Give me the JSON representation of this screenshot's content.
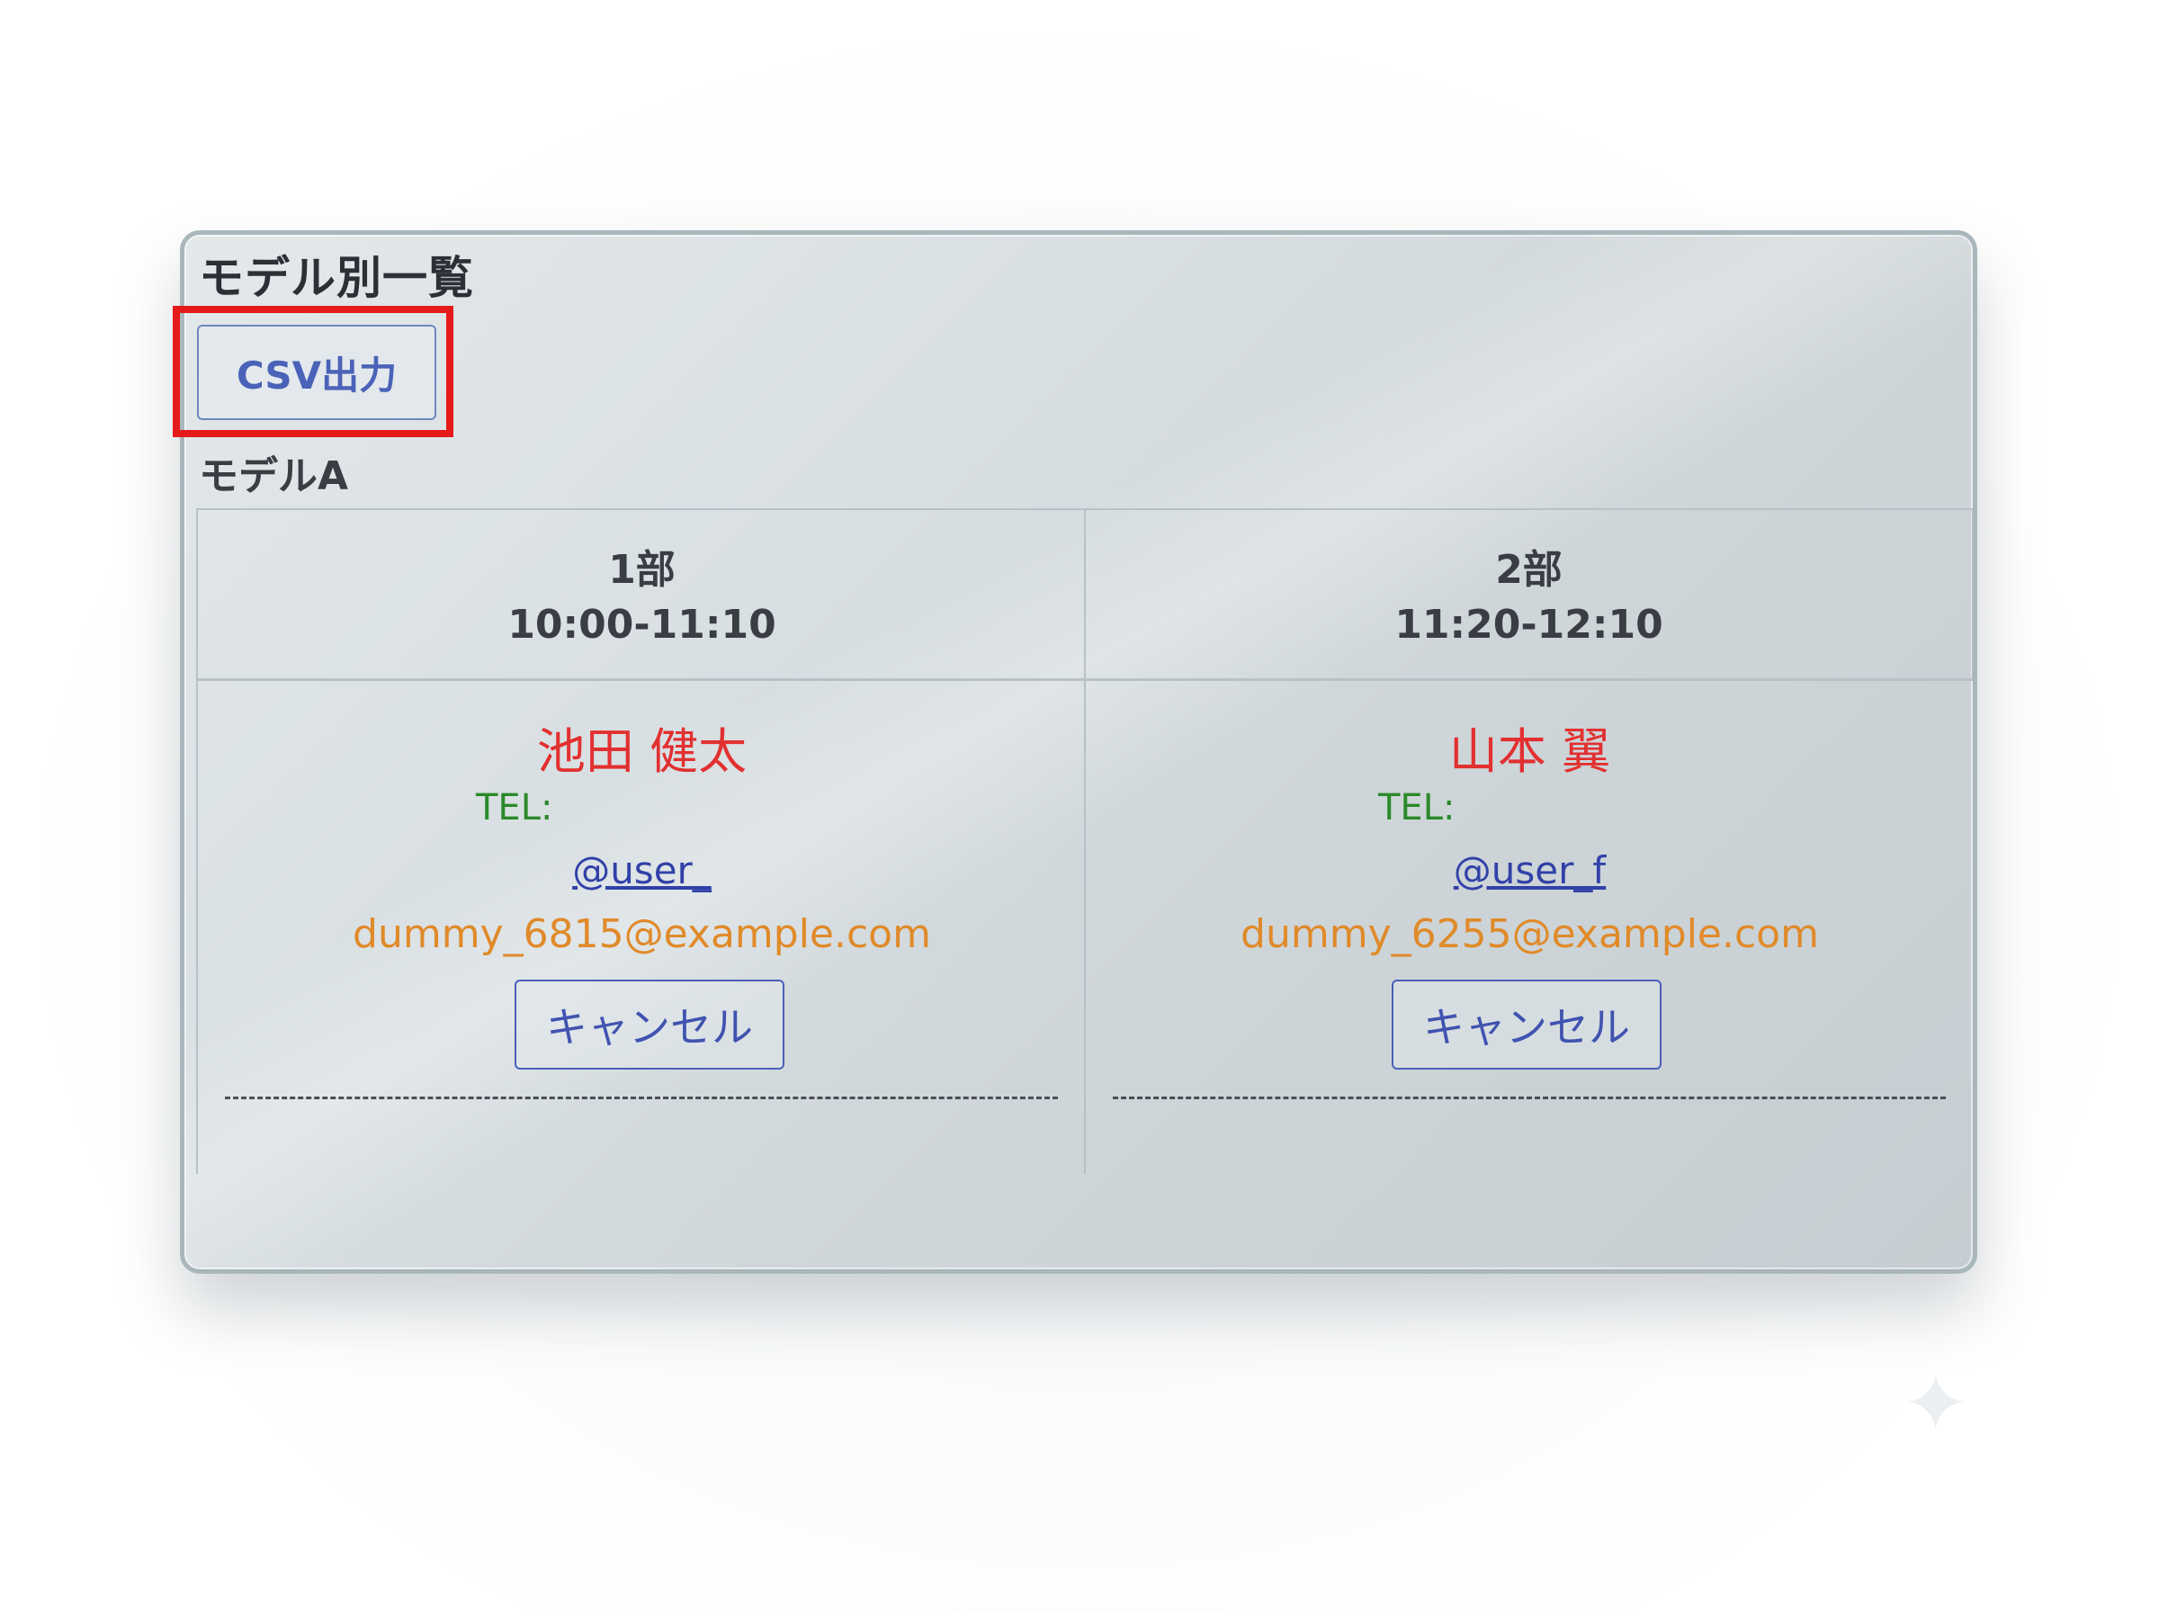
{
  "page_title": "モデル別一覧",
  "toolbar": {
    "csv_label": "CSV出力"
  },
  "model": {
    "name": "モデルA",
    "slots": [
      {
        "label": "1部",
        "time": "10:00-11:10",
        "name": "池田 健太",
        "tel_label": "TEL:",
        "handle": "@user_",
        "email": "dummy_6815@example.com",
        "cancel_label": "キャンセル"
      },
      {
        "label": "2部",
        "time": "11:20-12:10",
        "name": "山本 翼",
        "tel_label": "TEL:",
        "handle": "@user_f",
        "email": "dummy_6255@example.com",
        "cancel_label": "キャンセル"
      }
    ]
  },
  "colors": {
    "highlight": "#e51a1a",
    "name_red": "#e23030",
    "tel_green": "#2a8a2a",
    "email_orange": "#e08a2a",
    "link_blue": "#3141a8"
  },
  "icons": {
    "sparkle": "sparkle-icon"
  }
}
